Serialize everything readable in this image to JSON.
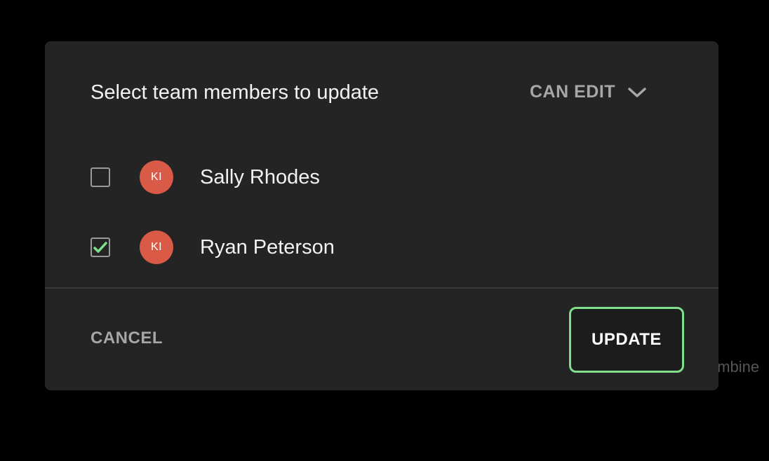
{
  "background": {
    "partial_text": "ombine"
  },
  "dialog": {
    "title": "Select team members to update",
    "permission": {
      "selected": "CAN EDIT",
      "icon": "chevron-down-icon"
    },
    "members": [
      {
        "initials": "KI",
        "name": "Sally Rhodes",
        "checked": false
      },
      {
        "initials": "KI",
        "name": "Ryan Peterson",
        "checked": true
      }
    ],
    "footer": {
      "cancel_label": "CANCEL",
      "update_label": "UPDATE"
    }
  },
  "colors": {
    "dialog_bg": "#242424",
    "avatar_bg": "#d85a47",
    "accent_green": "#7ee08a",
    "muted_text": "#a7a7a7"
  }
}
